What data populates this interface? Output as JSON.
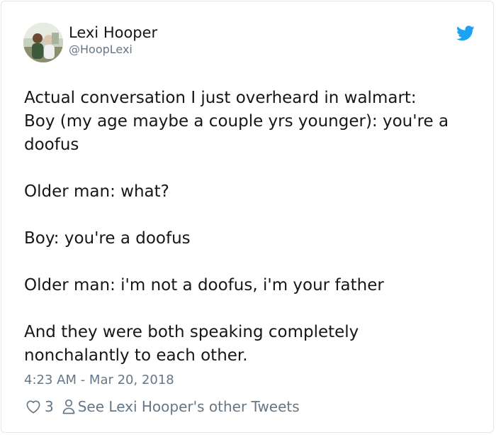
{
  "tweet": {
    "author_name": "Lexi Hooper",
    "author_handle": "@HoopLexi",
    "avatar_icon": "profile-photo",
    "brand_icon": "twitter-bird-icon",
    "brand_color": "#1da1f2",
    "paragraphs": [
      [
        "Actual conversation I just overheard in walmart:",
        "Boy (my age maybe a couple yrs younger): you're a",
        "doofus"
      ],
      [
        "Older man: what?"
      ],
      [
        "Boy: you're a doofus"
      ],
      [
        "Older man: i'm not a doofus, i'm your father"
      ],
      [
        "And they were both speaking completely",
        "nonchalantly to each other."
      ]
    ],
    "timestamp": "4:23 AM - Mar 20, 2018",
    "like_count": "3",
    "like_icon": "heart-icon",
    "profile_icon": "person-icon",
    "other_tweets_label": "See Lexi Hooper's other Tweets"
  }
}
